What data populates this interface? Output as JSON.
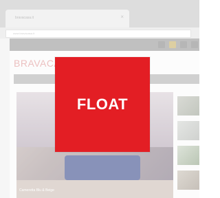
{
  "browser": {
    "tab_title": "bravacasa.it",
    "tab_close": "×",
    "url": "www.bravacasa.it"
  },
  "site": {
    "brand": "BRAVACASA",
    "hero_caption": "Cameretta Blu & Beige"
  },
  "badge": {
    "label": "FLOAT",
    "color": "#e31e24"
  }
}
